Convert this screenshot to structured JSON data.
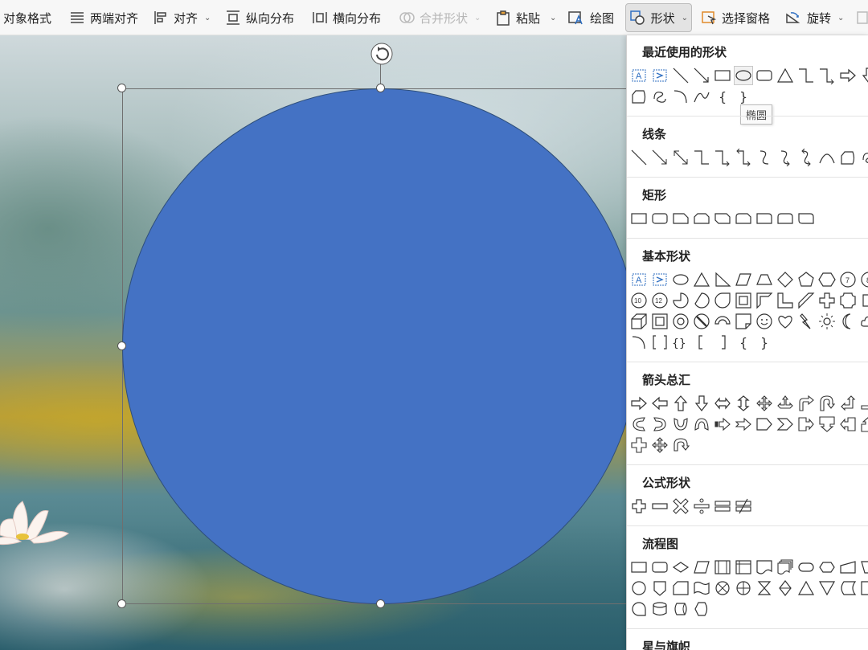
{
  "toolbar": {
    "object_format": "对象格式",
    "justify": "两端对齐",
    "align": "对齐",
    "distribute_vertical": "纵向分布",
    "distribute_horizontal": "横向分布",
    "merge_shapes": "合并形状",
    "paste": "粘贴",
    "draw": "绘图",
    "shapes": "形状",
    "selection_pane": "选择窗格",
    "rotate": "旋转"
  },
  "slide": {
    "shape_fill": "#4472c4",
    "shape": "ellipse",
    "selected": true
  },
  "panel": {
    "sections": {
      "recent": "最近使用的形状",
      "lines": "线条",
      "rectangles": "矩形",
      "basic": "基本形状",
      "arrows": "箭头总汇",
      "equation": "公式形状",
      "flowchart": "流程图",
      "stars": "星与旗帜"
    },
    "tooltip": "椭圆"
  },
  "colors": {
    "accent": "#4472c4",
    "toolbar_bg": "#f7f7f7",
    "panel_bg": "#ffffff"
  }
}
